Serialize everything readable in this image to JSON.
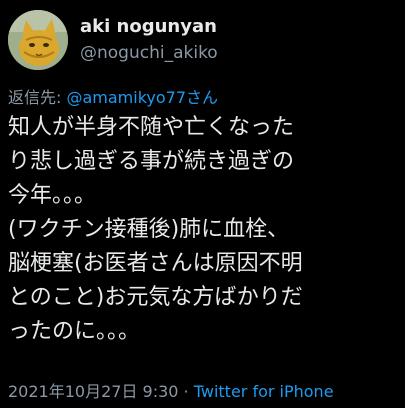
{
  "user": {
    "display_name": "aki nogunyan",
    "handle": "@noguchi_akiko"
  },
  "reply": {
    "label": "返信先: ",
    "mention": "@amamikyo77さん"
  },
  "tweet": {
    "lines": [
      "知人が半身不随や亡くなった",
      "り悲し過ぎる事が続き過ぎの",
      "今年。。。",
      "(ワクチン接種後)肺に血栓、",
      "脳梗塞(お医者さんは原因不明",
      "とのこと)お元気な方ばかりだ",
      "ったのに。。。"
    ]
  },
  "meta": {
    "timestamp": "2021年10月27日 9:30",
    "separator": " · ",
    "source": "Twitter for iPhone"
  },
  "colors": {
    "background": "#000000",
    "text": "#e7e9ea",
    "secondary": "#8b98a5",
    "link": "#1d9bf0"
  },
  "icons": {
    "avatar": "cat-avatar"
  }
}
